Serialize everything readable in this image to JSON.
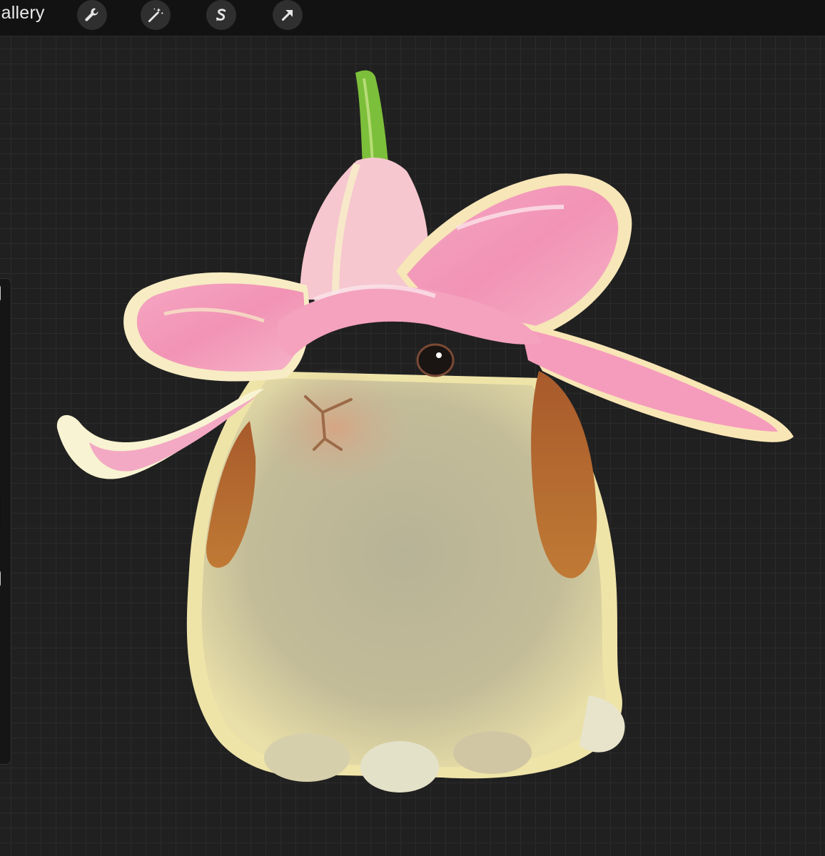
{
  "toolbar": {
    "gallery_label": "Gallery",
    "tools": [
      {
        "name": "actions",
        "icon": "wrench-icon"
      },
      {
        "name": "adjustments",
        "icon": "magic-wand-icon"
      },
      {
        "name": "selection",
        "icon": "selection-s-icon"
      },
      {
        "name": "transform",
        "icon": "arrow-cursor-icon"
      }
    ]
  },
  "canvas": {
    "artwork": "rabbit-with-lily-hat",
    "colors": {
      "background": "#202020",
      "grid": "#2b2b2b",
      "petal": "#f49ab8",
      "petal_highlight": "#f7f0c8",
      "stem": "#7cbf3a",
      "fur": "#b7b494",
      "ear": "#b2642e"
    }
  },
  "sidebar": {
    "controls": [
      "brush-size-slider",
      "undo-button",
      "opacity-slider"
    ]
  }
}
